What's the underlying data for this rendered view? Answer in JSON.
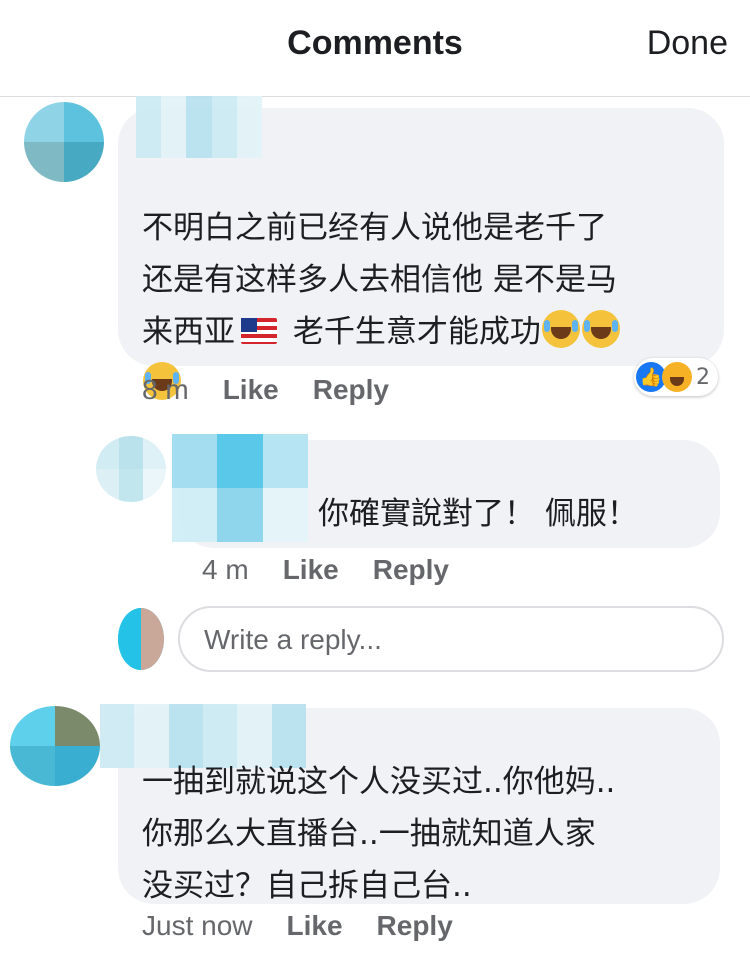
{
  "header": {
    "title": "Comments",
    "done_label": "Done"
  },
  "comments": [
    {
      "text": "不明白之前已经有人说他是老千了\n还是有这样多人去相信他 是不是马\n来西亚",
      "text_after_flag": " 老千生意才能成功",
      "time": "8 m",
      "like_label": "Like",
      "reply_label": "Reply",
      "reaction_count": "2",
      "reactions": [
        "like-icon",
        "haha-icon"
      ]
    },
    {
      "text": "你確實說對了！ 佩服！",
      "time": "4 m",
      "like_label": "Like",
      "reply_label": "Reply"
    },
    {
      "text": "一抽到就说这个人没买过..你他妈..\n你那么大直播台..一抽就知道人家\n没买过？自己拆自己台..",
      "time": "Just now",
      "like_label": "Like",
      "reply_label": "Reply"
    }
  ],
  "reply_input": {
    "placeholder": "Write a reply..."
  },
  "colors": {
    "bubble": "#f0f2f5",
    "meta_text": "#65676b",
    "like_blue": "#1877f2",
    "border": "#dcdde0"
  }
}
